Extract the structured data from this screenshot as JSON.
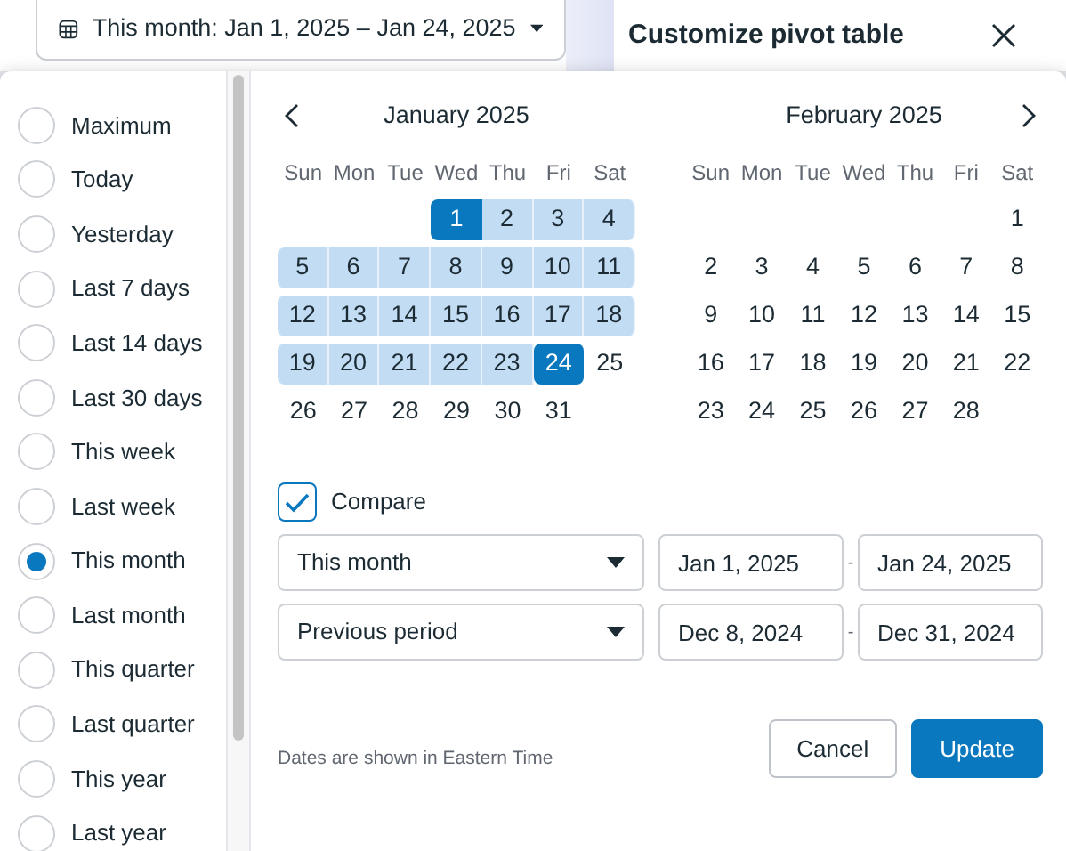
{
  "date_button": {
    "label": "This month: Jan 1, 2025 – Jan 24, 2025"
  },
  "side_panel": {
    "title": "Customize pivot table"
  },
  "presets": [
    {
      "label": "Maximum",
      "selected": false
    },
    {
      "label": "Today",
      "selected": false
    },
    {
      "label": "Yesterday",
      "selected": false
    },
    {
      "label": "Last 7 days",
      "selected": false
    },
    {
      "label": "Last 14 days",
      "selected": false
    },
    {
      "label": "Last 30 days",
      "selected": false
    },
    {
      "label": "This week",
      "selected": false
    },
    {
      "label": "Last week",
      "selected": false
    },
    {
      "label": "This month",
      "selected": true
    },
    {
      "label": "Last month",
      "selected": false
    },
    {
      "label": "This quarter",
      "selected": false
    },
    {
      "label": "Last quarter",
      "selected": false
    },
    {
      "label": "This year",
      "selected": false
    },
    {
      "label": "Last year",
      "selected": false
    }
  ],
  "months": [
    {
      "title": "January 2025",
      "weekdays": [
        "Sun",
        "Mon",
        "Tue",
        "Wed",
        "Thu",
        "Fri",
        "Sat"
      ],
      "weeks": [
        [
          {
            "day": "1",
            "selected": true,
            "in_range": true
          },
          {
            "day": "2",
            "selected": false,
            "in_range": true
          },
          {
            "day": "3",
            "selected": false,
            "in_range": true
          },
          {
            "day": "4",
            "selected": false,
            "in_range": true
          }
        ],
        [
          {
            "day": "5",
            "selected": false,
            "in_range": true
          },
          {
            "day": "6",
            "selected": false,
            "in_range": true
          },
          {
            "day": "7",
            "selected": false,
            "in_range": true
          },
          {
            "day": "8",
            "selected": false,
            "in_range": true
          },
          {
            "day": "9",
            "selected": false,
            "in_range": true
          },
          {
            "day": "10",
            "selected": false,
            "in_range": true
          },
          {
            "day": "11",
            "selected": false,
            "in_range": true
          }
        ],
        [
          {
            "day": "12",
            "selected": false,
            "in_range": true
          },
          {
            "day": "13",
            "selected": false,
            "in_range": true
          },
          {
            "day": "14",
            "selected": false,
            "in_range": true
          },
          {
            "day": "15",
            "selected": false,
            "in_range": true
          },
          {
            "day": "16",
            "selected": false,
            "in_range": true
          },
          {
            "day": "17",
            "selected": false,
            "in_range": true
          },
          {
            "day": "18",
            "selected": false,
            "in_range": true
          }
        ],
        [
          {
            "day": "19",
            "selected": false,
            "in_range": true
          },
          {
            "day": "20",
            "selected": false,
            "in_range": true
          },
          {
            "day": "21",
            "selected": false,
            "in_range": true
          },
          {
            "day": "22",
            "selected": false,
            "in_range": true
          },
          {
            "day": "23",
            "selected": false,
            "in_range": true
          },
          {
            "day": "24",
            "selected": true,
            "in_range": true
          },
          {
            "day": "25",
            "selected": false,
            "in_range": false
          }
        ],
        [
          {
            "day": "26",
            "selected": false,
            "in_range": false
          },
          {
            "day": "27",
            "selected": false,
            "in_range": false
          },
          {
            "day": "28",
            "selected": false,
            "in_range": false
          },
          {
            "day": "29",
            "selected": false,
            "in_range": false
          },
          {
            "day": "30",
            "selected": false,
            "in_range": false
          },
          {
            "day": "31",
            "selected": false,
            "in_range": false
          }
        ]
      ]
    },
    {
      "title": "February 2025",
      "weekdays": [
        "Sun",
        "Mon",
        "Tue",
        "Wed",
        "Thu",
        "Fri",
        "Sat"
      ],
      "weeks": [
        [
          {
            "day": "1",
            "selected": false,
            "in_range": false
          }
        ],
        [
          {
            "day": "2",
            "selected": false,
            "in_range": false
          },
          {
            "day": "3",
            "selected": false,
            "in_range": false
          },
          {
            "day": "4",
            "selected": false,
            "in_range": false
          },
          {
            "day": "5",
            "selected": false,
            "in_range": false
          },
          {
            "day": "6",
            "selected": false,
            "in_range": false
          },
          {
            "day": "7",
            "selected": false,
            "in_range": false
          },
          {
            "day": "8",
            "selected": false,
            "in_range": false
          }
        ],
        [
          {
            "day": "9",
            "selected": false,
            "in_range": false
          },
          {
            "day": "10",
            "selected": false,
            "in_range": false
          },
          {
            "day": "11",
            "selected": false,
            "in_range": false
          },
          {
            "day": "12",
            "selected": false,
            "in_range": false
          },
          {
            "day": "13",
            "selected": false,
            "in_range": false
          },
          {
            "day": "14",
            "selected": false,
            "in_range": false
          },
          {
            "day": "15",
            "selected": false,
            "in_range": false
          }
        ],
        [
          {
            "day": "16",
            "selected": false,
            "in_range": false
          },
          {
            "day": "17",
            "selected": false,
            "in_range": false
          },
          {
            "day": "18",
            "selected": false,
            "in_range": false
          },
          {
            "day": "19",
            "selected": false,
            "in_range": false
          },
          {
            "day": "20",
            "selected": false,
            "in_range": false
          },
          {
            "day": "21",
            "selected": false,
            "in_range": false
          },
          {
            "day": "22",
            "selected": false,
            "in_range": false
          }
        ],
        [
          {
            "day": "23",
            "selected": false,
            "in_range": false
          },
          {
            "day": "24",
            "selected": false,
            "in_range": false
          },
          {
            "day": "25",
            "selected": false,
            "in_range": false
          },
          {
            "day": "26",
            "selected": false,
            "in_range": false
          },
          {
            "day": "27",
            "selected": false,
            "in_range": false
          },
          {
            "day": "28",
            "selected": false,
            "in_range": false
          }
        ]
      ]
    }
  ],
  "compare": {
    "label": "Compare",
    "checked": true
  },
  "ranges": [
    {
      "preset": "This month",
      "start": "Jan 1, 2025",
      "separator": "-",
      "end": "Jan 24, 2025"
    },
    {
      "preset": "Previous period",
      "start": "Dec 8, 2024",
      "separator": "-",
      "end": "Dec 31, 2024"
    }
  ],
  "footnote": "Dates are shown in Eastern Time",
  "buttons": [
    {
      "label": "Cancel",
      "kind": "secondary"
    },
    {
      "label": "Update",
      "kind": "primary"
    }
  ]
}
